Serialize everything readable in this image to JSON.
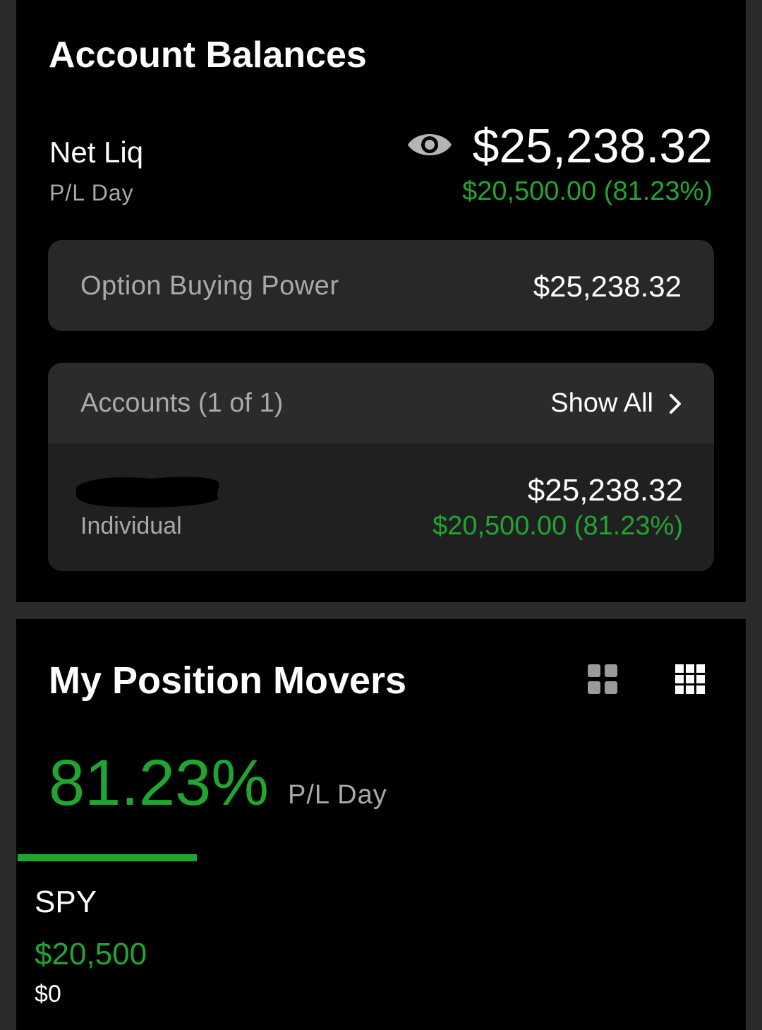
{
  "account_balances": {
    "title": "Account Balances",
    "net_liq_label": "Net Liq",
    "pl_day_label": "P/L Day",
    "net_liq_value": "$25,238.32",
    "pl_day_value": "$20,500.00 (81.23%)",
    "option_buying_power": {
      "label": "Option Buying Power",
      "value": "$25,238.32"
    },
    "accounts": {
      "count_label": "Accounts (1 of 1)",
      "show_all_label": "Show All",
      "items": [
        {
          "type": "Individual",
          "value": "$25,238.32",
          "pl": "$20,500.00 (81.23%)"
        }
      ]
    }
  },
  "position_movers": {
    "title": "My Position Movers",
    "pl_percent": "81.23%",
    "pl_label": "P/L Day",
    "positions": [
      {
        "symbol": "SPY",
        "pl": "$20,500",
        "value": "$0"
      }
    ]
  },
  "colors": {
    "positive": "#21a532",
    "card_bg": "#000000",
    "panel_bg": "#282828"
  }
}
